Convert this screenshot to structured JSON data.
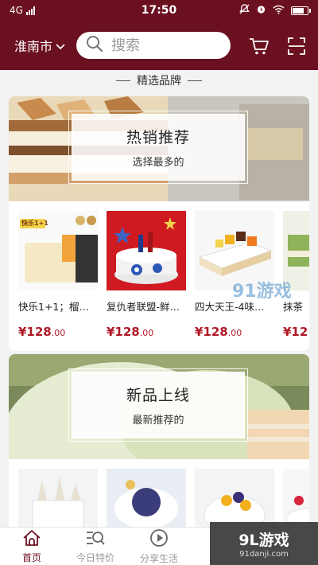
{
  "status": {
    "network": "4G",
    "time": "17:50",
    "battery_level": 0.9
  },
  "header": {
    "city": "淮南市",
    "search_placeholder": "搜索"
  },
  "section": {
    "title": "精选品牌"
  },
  "cards": [
    {
      "title": "热销推荐",
      "subtitle": "选择最多的",
      "products": [
        {
          "name": "快乐1+1；榴…",
          "price": "¥128",
          "cents": ".00",
          "badge": "快乐1+1"
        },
        {
          "name": "复仇者联盟-鲜…",
          "price": "¥128",
          "cents": ".00"
        },
        {
          "name": "四大天王-4味…",
          "price": "¥128",
          "cents": ".00"
        },
        {
          "name": "抹茶",
          "price": "¥12",
          "cents": ""
        }
      ]
    },
    {
      "title": "新品上线",
      "subtitle": "最新推荐的",
      "products": [
        {
          "name": "",
          "price": "",
          "cents": ""
        },
        {
          "name": "",
          "price": "",
          "cents": ""
        },
        {
          "name": "",
          "price": "",
          "cents": ""
        },
        {
          "name": "",
          "price": "",
          "cents": ""
        }
      ]
    }
  ],
  "tabs": [
    {
      "label": "首页",
      "icon": "home-icon",
      "active": true
    },
    {
      "label": "今日特价",
      "icon": "discount-search-icon",
      "active": false
    },
    {
      "label": "分享生活",
      "icon": "play-circle-icon",
      "active": false
    }
  ],
  "watermark": {
    "text": "9L游戏",
    "domain": "91danji.com",
    "corner_text": "91游戏"
  },
  "colors": {
    "brand": "#6b1020",
    "price": "#b01a28"
  }
}
